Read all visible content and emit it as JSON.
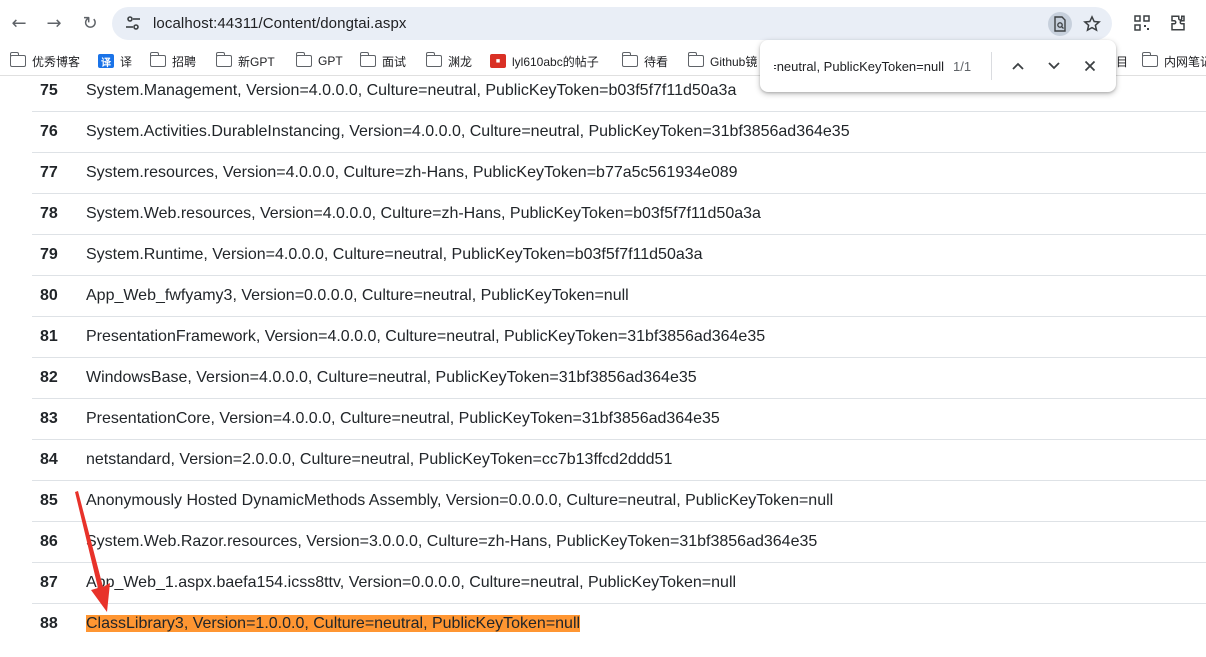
{
  "browser": {
    "url": "localhost:44311/Content/dongtai.aspx",
    "back_icon": "←",
    "forward_icon": "→",
    "reload_icon": "↻"
  },
  "bookmarks": [
    {
      "label": "优秀博客",
      "icon": "folder"
    },
    {
      "label": "译",
      "icon": "badge-blue"
    },
    {
      "label": "招聘",
      "icon": "folder"
    },
    {
      "label": "新GPT",
      "icon": "folder"
    },
    {
      "label": "GPT",
      "icon": "folder"
    },
    {
      "label": "面试",
      "icon": "folder"
    },
    {
      "label": "渊龙",
      "icon": "folder"
    },
    {
      "label": "lyl610abc的帖子",
      "icon": "badge-red"
    },
    {
      "label": "待看",
      "icon": "folder"
    },
    {
      "label": "Github镜",
      "icon": "folder"
    },
    {
      "label": "目",
      "icon": "none"
    },
    {
      "label": "内网笔记",
      "icon": "folder"
    }
  ],
  "find_bar": {
    "query": "System.Runtime, Culture=neutral, PublicKeyToken=null",
    "count": "1/1"
  },
  "rows": [
    {
      "num": "75",
      "name": "System.Management, Version=4.0.0.0, Culture=neutral, PublicKeyToken=b03f5f7f11d50a3a"
    },
    {
      "num": "76",
      "name": "System.Activities.DurableInstancing, Version=4.0.0.0, Culture=neutral, PublicKeyToken=31bf3856ad364e35"
    },
    {
      "num": "77",
      "name": "System.resources, Version=4.0.0.0, Culture=zh-Hans, PublicKeyToken=b77a5c561934e089"
    },
    {
      "num": "78",
      "name": "System.Web.resources, Version=4.0.0.0, Culture=zh-Hans, PublicKeyToken=b03f5f7f11d50a3a"
    },
    {
      "num": "79",
      "name": "System.Runtime, Version=4.0.0.0, Culture=neutral, PublicKeyToken=b03f5f7f11d50a3a"
    },
    {
      "num": "80",
      "name": "App_Web_fwfyamy3, Version=0.0.0.0, Culture=neutral, PublicKeyToken=null"
    },
    {
      "num": "81",
      "name": "PresentationFramework, Version=4.0.0.0, Culture=neutral, PublicKeyToken=31bf3856ad364e35"
    },
    {
      "num": "82",
      "name": "WindowsBase, Version=4.0.0.0, Culture=neutral, PublicKeyToken=31bf3856ad364e35"
    },
    {
      "num": "83",
      "name": "PresentationCore, Version=4.0.0.0, Culture=neutral, PublicKeyToken=31bf3856ad364e35"
    },
    {
      "num": "84",
      "name": "netstandard, Version=2.0.0.0, Culture=neutral, PublicKeyToken=cc7b13ffcd2ddd51"
    },
    {
      "num": "85",
      "name": "Anonymously Hosted DynamicMethods Assembly, Version=0.0.0.0, Culture=neutral, PublicKeyToken=null"
    },
    {
      "num": "86",
      "name": "System.Web.Razor.resources, Version=3.0.0.0, Culture=zh-Hans, PublicKeyToken=31bf3856ad364e35"
    },
    {
      "num": "87",
      "name": "App_Web_1.aspx.baefa154.icss8ttv, Version=0.0.0.0, Culture=neutral, PublicKeyToken=null"
    },
    {
      "num": "88",
      "name": "ClassLibrary3, Version=1.0.0.0, Culture=neutral, PublicKeyToken=null",
      "highlight": true
    }
  ],
  "colors": {
    "find_highlight": "#ff9632",
    "annotation_arrow": "#e8322a"
  }
}
